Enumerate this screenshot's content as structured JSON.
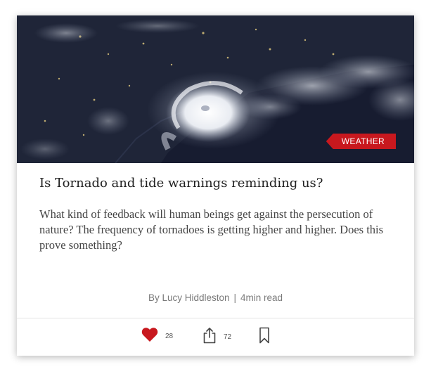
{
  "article": {
    "category": "WEATHER",
    "title": "Is Tornado and tide warnings reminding us?",
    "excerpt": "What kind of feedback will human beings get against the persecution of nature? The frequency of tornadoes is getting higher and higher. Does this prove something?",
    "author": "By Lucy Hiddleston",
    "separator": "|",
    "read_time": "4min read",
    "hero_image": "satellite-hurricane-image"
  },
  "actions": {
    "likes": "28",
    "shares": "72",
    "like_icon": "heart-icon",
    "share_icon": "share-icon",
    "bookmark_icon": "bookmark-icon"
  },
  "colors": {
    "accent": "#c8181e",
    "heart": "#c8181e",
    "title": "#222222",
    "body": "#444444",
    "meta": "#7a7a7a"
  }
}
